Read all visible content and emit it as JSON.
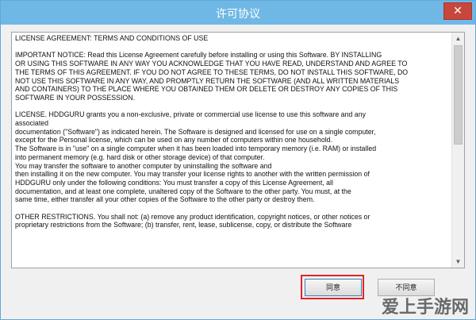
{
  "window": {
    "title": "许可协议",
    "close_label": "✕"
  },
  "license": {
    "paragraphs": [
      "LICENSE AGREEMENT: TERMS AND CONDITIONS OF USE",
      "IMPORTANT NOTICE: Read this License Agreement carefully before installing or using this Software. BY INSTALLING\nOR USING THIS SOFTWARE IN ANY WAY YOU ACKNOWLEDGE THAT YOU HAVE READ, UNDERSTAND AND AGREE TO\nTHE TERMS OF THIS AGREEMENT. IF YOU DO NOT AGREE TO THESE TERMS, DO NOT INSTALL THIS SOFTWARE, DO\nNOT USE THIS SOFTWARE IN ANY WAY, AND PROMPTLY RETURN THE SOFTWARE (AND ALL WRITTEN MATERIALS\nAND CONTAINERS) TO THE PLACE WHERE YOU OBTAINED THEM OR DELETE OR DESTROY ANY COPIES OF THIS\nSOFTWARE IN YOUR POSSESSION.",
      "LICENSE. HDDGURU grants you a non-exclusive, private or commercial use license to use this software and any\nassociated\ndocumentation (\"Software\") as indicated herein.  The Software is designed and licensed for use on a single computer,\nexcept for the Personal license, which can be used on any number of computers within one household.\nThe Software is in \"use\" on a single computer when it has been loaded into temporary memory (i.e. RAM) or installed\ninto permanent memory (e.g. hard disk or other storage device) of that computer.\nYou may transfer the software to another computer by uninstalling the software and\nthen installing it on the new computer. You may transfer your license rights to another with the written permission of\nHDDGURU only under the following conditions: You must transfer a copy of this License Agreement, all\ndocumentation, and at least one complete, unaltered copy of the Software to the other party.  You must, at the\nsame time, either transfer all your other copies of the Software to the other party or destroy them.",
      "OTHER RESTRICTIONS. You shall not: (a) remove any product identification, copyright notices, or other notices or\nproprietary restrictions from the Software; (b) transfer, rent, lease, sublicense, copy, or distribute the Software"
    ]
  },
  "buttons": {
    "agree": "同意",
    "disagree": "不同意"
  },
  "watermark": "爱上手游网",
  "colors": {
    "titlebar": "#6fb8e6",
    "highlight": "#e0232b",
    "close": "#c9463d"
  }
}
